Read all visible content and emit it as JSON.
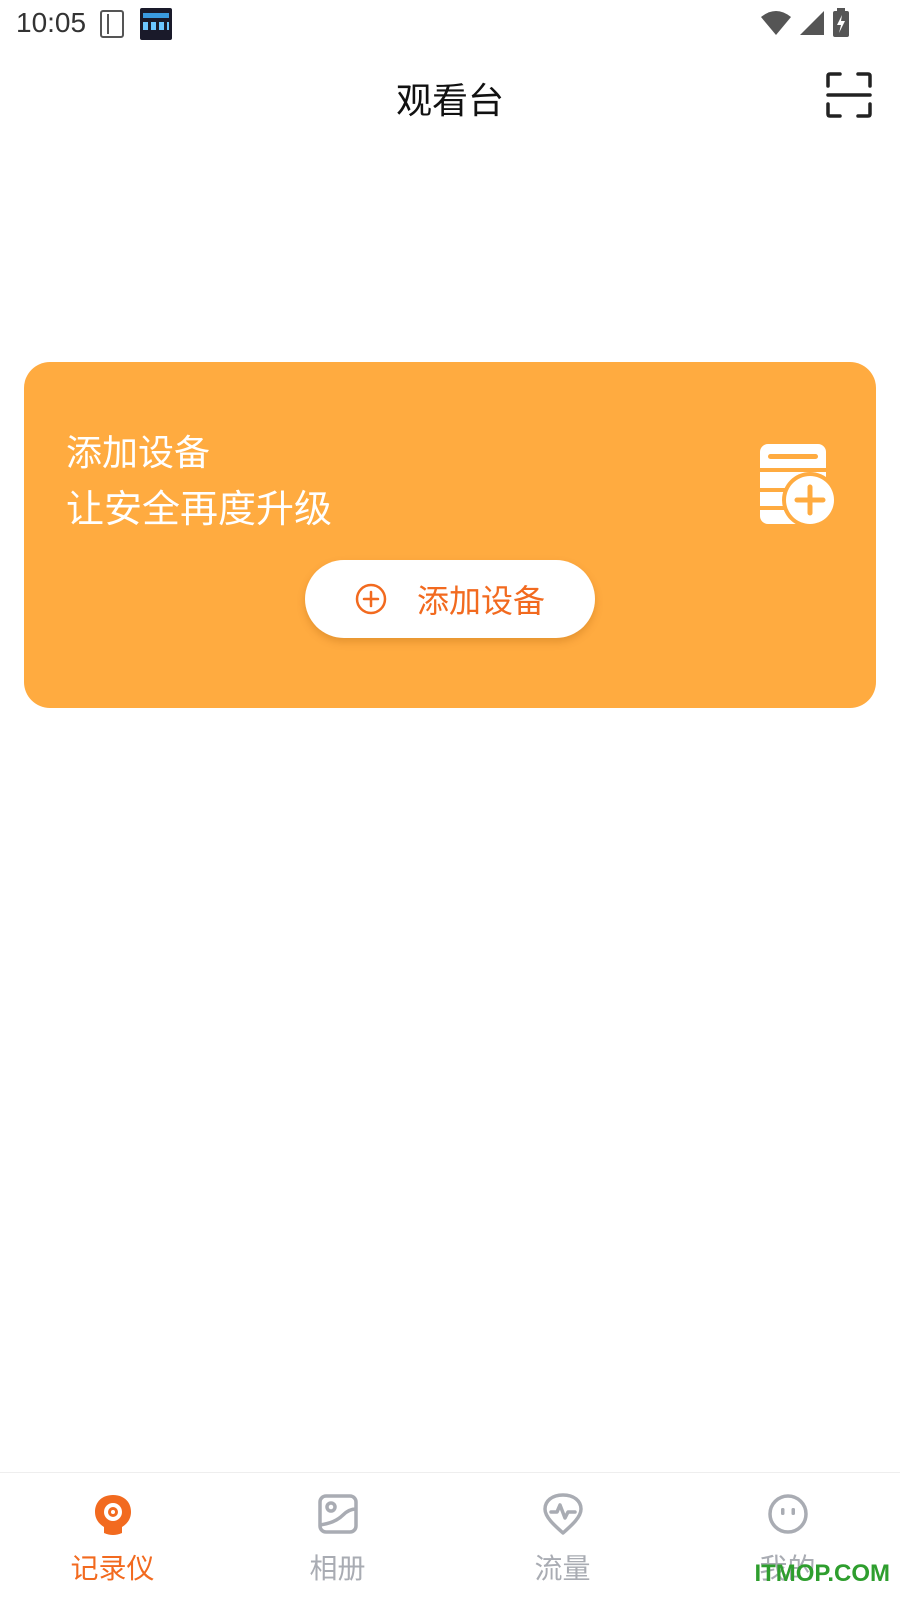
{
  "status_bar": {
    "time": "10:05",
    "icons": [
      "notebook-icon",
      "clock-app-icon",
      "wifi-icon",
      "signal-icon",
      "battery-charging-icon"
    ]
  },
  "header": {
    "title": "观看台",
    "scan_icon": "scan-icon"
  },
  "promo_card": {
    "title": "添加设备",
    "subtitle": "让安全再度升级",
    "button_label": "添加设备",
    "button_icon": "plus-circle-icon",
    "illustration": "device-add-icon",
    "background_color": "#ffab40",
    "accent_color": "#f26a1f"
  },
  "bottom_nav": {
    "active_color": "#f26a1f",
    "inactive_color": "#a9acb3",
    "items": [
      {
        "label": "记录仪",
        "icon": "camera-pin-icon",
        "active": true
      },
      {
        "label": "相册",
        "icon": "image-icon",
        "active": false
      },
      {
        "label": "流量",
        "icon": "pulse-pin-icon",
        "active": false
      },
      {
        "label": "我的",
        "icon": "smiley-icon",
        "active": false
      }
    ]
  },
  "watermark": "ITMOP.COM"
}
